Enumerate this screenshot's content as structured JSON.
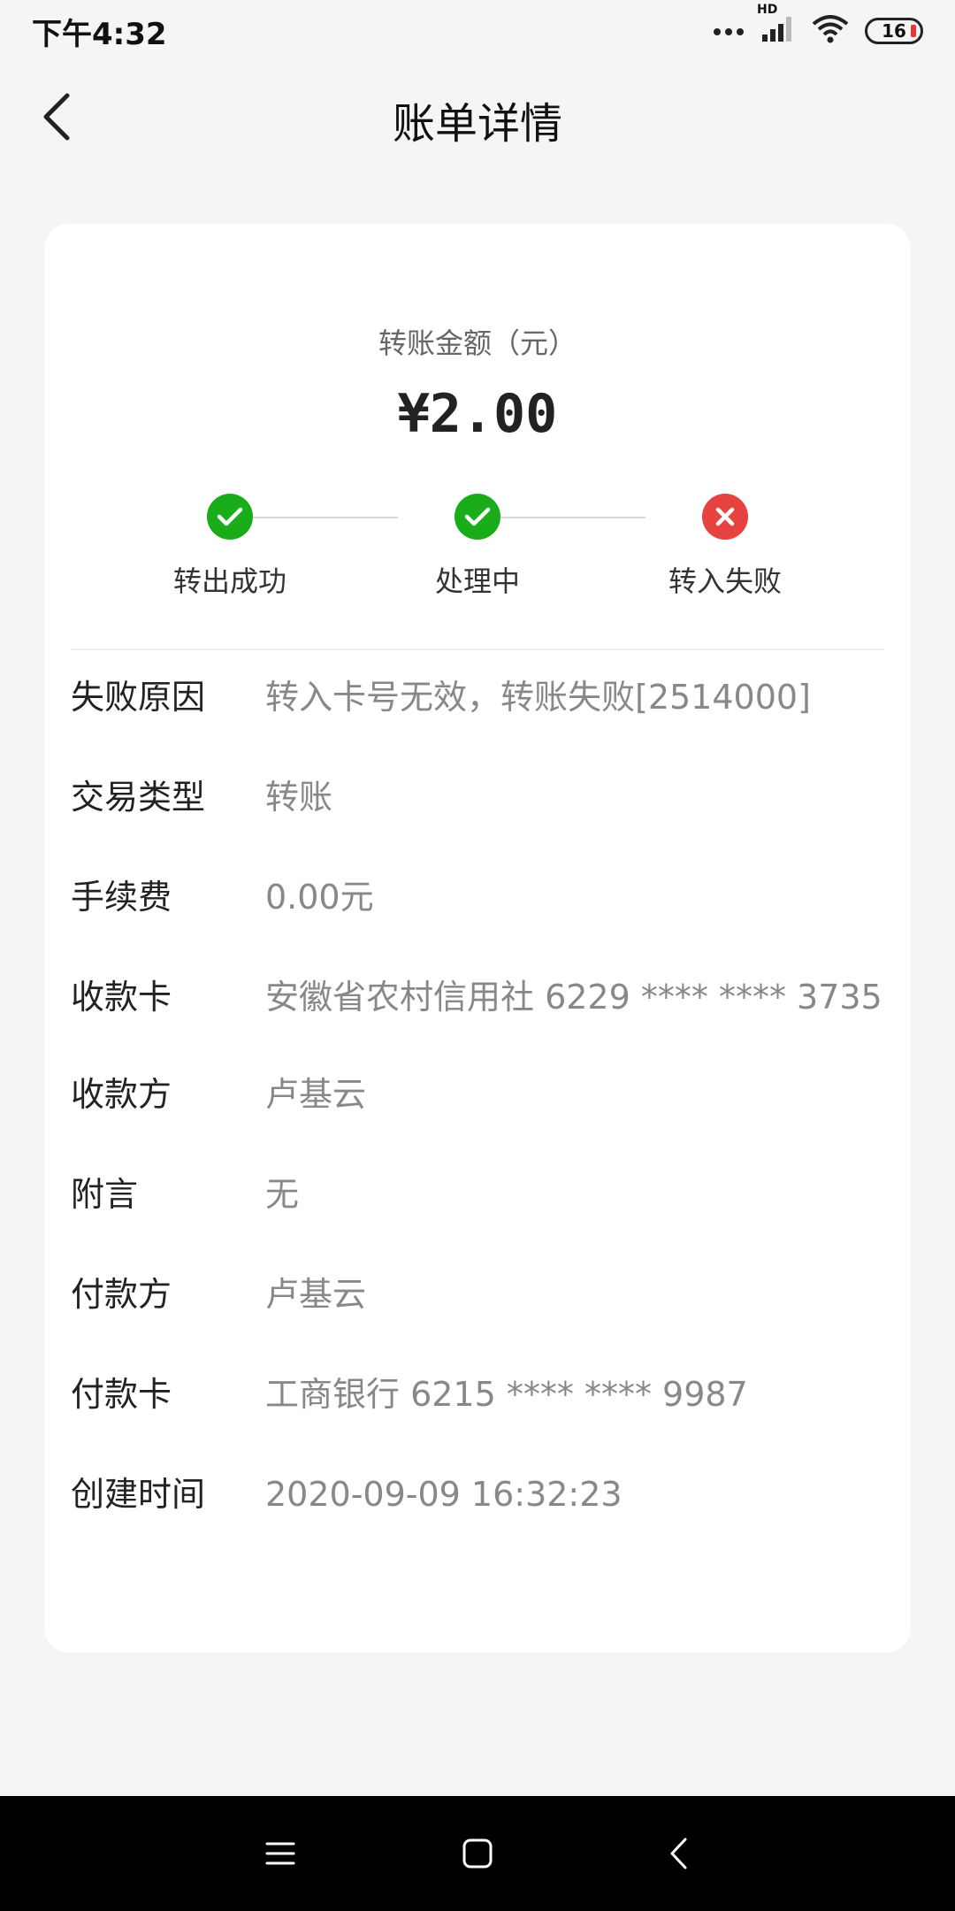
{
  "status_bar": {
    "time": "下午4:32",
    "battery_level": "16",
    "network_label": "HD"
  },
  "header": {
    "title": "账单详情"
  },
  "transfer": {
    "amount_label": "转账金额（元）",
    "amount": "¥2.00"
  },
  "steps": [
    {
      "label": "转出成功",
      "status": "success"
    },
    {
      "label": "处理中",
      "status": "success"
    },
    {
      "label": "转入失败",
      "status": "failed"
    }
  ],
  "details": [
    {
      "key": "失败原因",
      "value": "转入卡号无效，转账失败[2514000]"
    },
    {
      "key": "交易类型",
      "value": "转账"
    },
    {
      "key": "手续费",
      "value": "0.00元"
    },
    {
      "key": "收款卡",
      "value": "安徽省农村信用社 6229 **** **** 3735"
    },
    {
      "key": "收款方",
      "value": "卢基云"
    },
    {
      "key": "附言",
      "value": "无"
    },
    {
      "key": "付款方",
      "value": "卢基云"
    },
    {
      "key": "付款卡",
      "value": "工商银行 6215 **** **** 9987"
    },
    {
      "key": "创建时间",
      "value": "2020-09-09 16:32:23"
    }
  ],
  "colors": {
    "success": "#1aad19",
    "failed": "#e64340"
  }
}
